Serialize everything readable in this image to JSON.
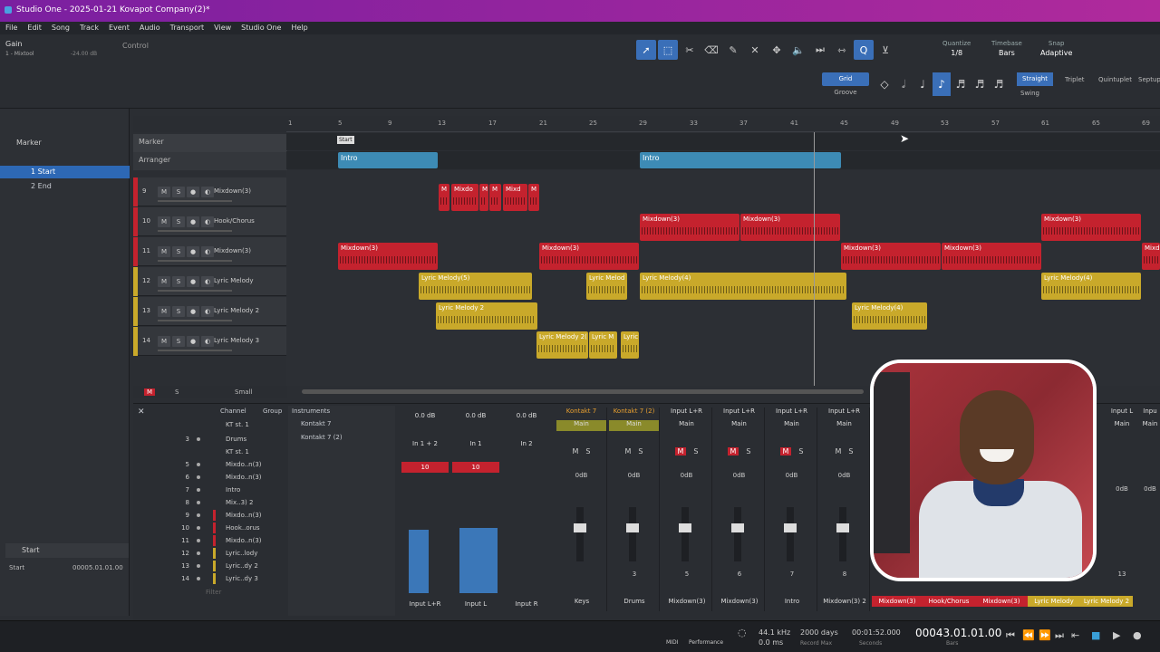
{
  "window": {
    "title": "Studio One - 2025-01-21 Kovapot Company(2)*"
  },
  "menu": [
    "File",
    "Edit",
    "Song",
    "Track",
    "Event",
    "Audio",
    "Transport",
    "View",
    "Studio One",
    "Help"
  ],
  "toolbar": {
    "gain_label": "Gain",
    "gain_sub": "1 - Mixtool",
    "gain_value": "-24.00 dB",
    "control_label": "Control",
    "quantize_label": "Quantize",
    "quantize_value": "1/8",
    "timebase_label": "Timebase",
    "timebase_value": "Bars",
    "snap_label": "Snap",
    "snap_value": "Adaptive",
    "grid": "Grid",
    "groove": "Groove",
    "straight": "Straight",
    "triplet": "Triplet",
    "quintuplet": "Quintuplet",
    "septuplet": "Septup",
    "swing": "Swing"
  },
  "left": {
    "marker_header": "Marker",
    "markers": [
      {
        "num": "1",
        "name": "Start"
      },
      {
        "num": "2",
        "name": "End"
      }
    ],
    "bottom_title": "Start",
    "bottom_label": "Start",
    "bottom_value": "00005.01.01.00"
  },
  "arranger": {
    "marker_label": "Marker",
    "arranger_label": "Arranger",
    "ruler": [
      "1",
      "5",
      "9",
      "13",
      "17",
      "21",
      "25",
      "29",
      "33",
      "37",
      "41",
      "45",
      "49",
      "53",
      "57",
      "61",
      "65",
      "69"
    ],
    "start_flag": "Start",
    "sections": [
      "Intro",
      "Intro"
    ],
    "footer_m": "M",
    "footer_s": "S",
    "footer_small": "Small"
  },
  "tracks": [
    {
      "num": "9",
      "name": "Mixdown(3)",
      "color": "red"
    },
    {
      "num": "10",
      "name": "Hook/Chorus",
      "color": "red"
    },
    {
      "num": "11",
      "name": "Mixdown(3)",
      "color": "red"
    },
    {
      "num": "12",
      "name": "Lyric Melody",
      "color": "yellow"
    },
    {
      "num": "13",
      "name": "Lyric Melody 2",
      "color": "yellow"
    },
    {
      "num": "14",
      "name": "Lyric Melody 3",
      "color": "yellow"
    }
  ],
  "clips": {
    "t9": [
      "M",
      "Mixdo",
      "M",
      "M",
      "Mixd",
      "M"
    ],
    "t10": [
      "Mixdown(3)",
      "Mixdown(3)",
      "Mixdown(3)"
    ],
    "t11": [
      "Mixdown(3)",
      "Mixdown(3)",
      "Mixdown(3)",
      "Mixdown(3)",
      "Mixd"
    ],
    "t12": [
      "Lyric Melody(5)",
      "Lyric Melod",
      "Lyric Melody(4)",
      "Lyric Melody(4)"
    ],
    "t13": [
      "Lyric Melody 2",
      "Lyric Melody(4)"
    ],
    "t14": [
      "Lyric Melody 2(",
      "Lyric M",
      "Lyric"
    ]
  },
  "console": {
    "channel_header": "Channel",
    "group_header": "Group",
    "instruments_header": "Instruments",
    "instruments": [
      "Kontakt 7",
      "Kontakt 7 (2)"
    ],
    "channels": [
      {
        "n": "",
        "name": "KT st. 1"
      },
      {
        "n": "3",
        "name": "Drums"
      },
      {
        "n": "",
        "name": "KT st. 1"
      },
      {
        "n": "5",
        "name": "Mixdo..n(3)"
      },
      {
        "n": "6",
        "name": "Mixdo..n(3)"
      },
      {
        "n": "7",
        "name": "Intro"
      },
      {
        "n": "8",
        "name": "Mix..3) 2"
      },
      {
        "n": "9",
        "name": "Mixdo..n(3)"
      },
      {
        "n": "10",
        "name": "Hook..orus"
      },
      {
        "n": "11",
        "name": "Mixdo..n(3)"
      },
      {
        "n": "12",
        "name": "Lyric..lody"
      },
      {
        "n": "13",
        "name": "Lyric..dy 2"
      },
      {
        "n": "14",
        "name": "Lyric..dy 3"
      }
    ],
    "filter": "Filter",
    "inputs": [
      {
        "db": "0.0 dB",
        "io": "In 1 + 2",
        "val": "10",
        "label": "Input L+R"
      },
      {
        "db": "0.0 dB",
        "io": "In 1",
        "val": "10",
        "label": "Input L"
      },
      {
        "db": "0.0 dB",
        "io": "In 2",
        "val": "",
        "label": "Input R"
      }
    ],
    "strips": [
      {
        "top": "Kontakt 7",
        "route": "Main",
        "db": "0dB",
        "n": "",
        "bottom": "Keys",
        "color": ""
      },
      {
        "top": "Kontakt 7 (2)",
        "route": "Main",
        "db": "0dB",
        "n": "3",
        "bottom": "Drums",
        "color": ""
      },
      {
        "top": "Input L+R",
        "route": "Main",
        "db": "0dB",
        "n": "5",
        "bottom": "Mixdown(3)",
        "color": ""
      },
      {
        "top": "Input L+R",
        "route": "Main",
        "db": "0dB",
        "n": "6",
        "bottom": "Mixdown(3)",
        "color": ""
      },
      {
        "top": "Input L+R",
        "route": "Main",
        "db": "0dB",
        "n": "7",
        "bottom": "Intro",
        "color": ""
      },
      {
        "top": "Input L+R",
        "route": "Main",
        "db": "0dB",
        "n": "8",
        "bottom": "Mixdown(3) 2",
        "color": ""
      }
    ],
    "bottom_labels": [
      "Mixdown(3)",
      "Hook/Chorus",
      "Mixdown(3)",
      "Lyric Melody",
      "Lyric Melody 2"
    ],
    "right_strips": [
      {
        "top": "Input L",
        "route": "Main",
        "db": "0dB",
        "n": "13"
      },
      {
        "top": "Inpu",
        "route": "Main",
        "db": "0dB",
        "n": "1"
      }
    ]
  },
  "transport": {
    "midi": "MIDI",
    "performance": "Performance",
    "rate": "44.1 kHz",
    "latency": "0.0 ms",
    "days": "2000 days",
    "record_max": "Record Max",
    "time": "00:01:52.000",
    "seconds": "Seconds",
    "bars": "Bars",
    "position": "00043.01.01.00"
  }
}
